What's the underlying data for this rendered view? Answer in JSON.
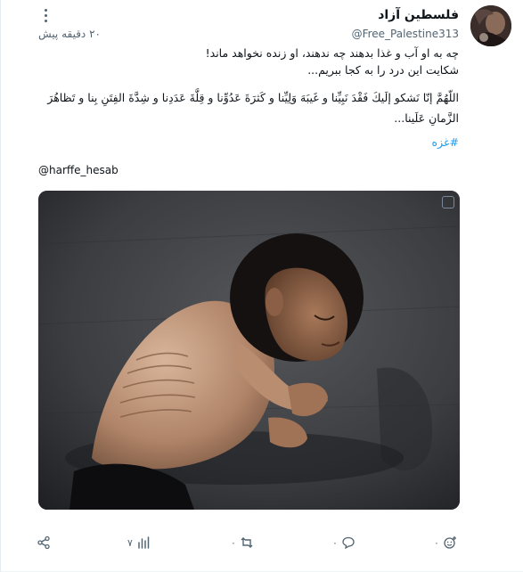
{
  "post": {
    "author_name": "فلسطین آزاد",
    "author_handle": "@Free_Palestine313",
    "timestamp": "۲۰ دقیقه پیش",
    "body_line_1": "چه به او آب و غذا بدهند چه ندهند، او زنده نخواهد ماند!",
    "body_line_2": "شکایت این درد را به کجا ببریم...",
    "dua": "اللّهُمَّ إنّا نَشكو إلَيكَ فَقْدَ نَبِيِّنا و غَيبَهَ وَلِيِّنا و كَثرَةَ عَدُوِّنا و قِلَّةَ عَدَدِنا و شِدَّةَ الفِتَنِ بِنا و تَظاهُرَ الزَّمانِ عَلَينا...",
    "hashtag": "#غزه",
    "credit": "@harffe_hesab"
  },
  "actions": {
    "reactions": {
      "icon": "add-reaction-icon",
      "count": "۰"
    },
    "comments": {
      "icon": "comment-icon",
      "count": "۰"
    },
    "reposts": {
      "icon": "repost-icon",
      "count": "۰"
    },
    "views": {
      "icon": "views-chart-icon",
      "count": "۷"
    },
    "share": {
      "icon": "share-icon"
    }
  },
  "colors": {
    "text": "#0f1419",
    "muted": "#536471",
    "link": "#1d9bf0"
  }
}
